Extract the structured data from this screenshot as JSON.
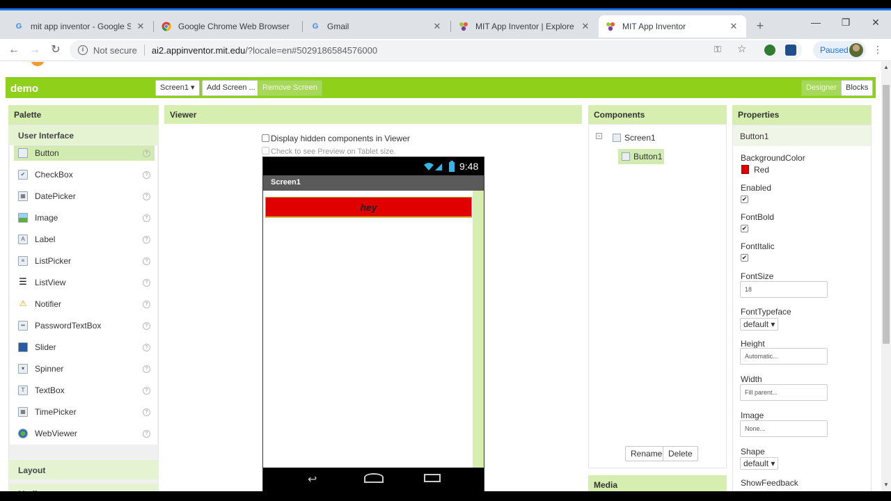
{
  "browser": {
    "tabs": [
      {
        "title": "mit app inventor - Google Sea",
        "icon": "google-g"
      },
      {
        "title": "Google Chrome Web Browser",
        "icon": "chrome"
      },
      {
        "title": "Gmail",
        "icon": "google-g"
      },
      {
        "title": "MIT App Inventor | Explore MI",
        "icon": "app-inventor"
      },
      {
        "title": "MIT App Inventor",
        "icon": "app-inventor"
      }
    ],
    "address": {
      "security_label": "Not secure",
      "host": "ai2.appinventor.mit.edu",
      "path": "/?locale=en#5029186584576000"
    },
    "profile_status": "Paused"
  },
  "project": {
    "name": "demo",
    "screen_select": "Screen1 ▾",
    "add_screen": "Add Screen ...",
    "remove_screen": "Remove Screen",
    "designer": "Designer",
    "blocks": "Blocks"
  },
  "palette": {
    "title": "Palette",
    "category": "User Interface",
    "items": [
      {
        "label": "Button",
        "icon": "button-icon"
      },
      {
        "label": "CheckBox",
        "icon": "checkbox-icon"
      },
      {
        "label": "DatePicker",
        "icon": "datepicker-icon"
      },
      {
        "label": "Image",
        "icon": "image-icon"
      },
      {
        "label": "Label",
        "icon": "label-icon"
      },
      {
        "label": "ListPicker",
        "icon": "listpicker-icon"
      },
      {
        "label": "ListView",
        "icon": "listview-icon"
      },
      {
        "label": "Notifier",
        "icon": "notifier-icon"
      },
      {
        "label": "PasswordTextBox",
        "icon": "password-icon"
      },
      {
        "label": "Slider",
        "icon": "slider-icon"
      },
      {
        "label": "Spinner",
        "icon": "spinner-icon"
      },
      {
        "label": "TextBox",
        "icon": "textbox-icon"
      },
      {
        "label": "TimePicker",
        "icon": "timepicker-icon"
      },
      {
        "label": "WebViewer",
        "icon": "webviewer-icon"
      }
    ],
    "help_glyph": "?",
    "layout": "Layout",
    "media": "Media"
  },
  "viewer": {
    "title": "Viewer",
    "show_hidden": "Display hidden components in Viewer",
    "tablet_preview": "Check to see Preview on Tablet size.",
    "clock": "9:48",
    "screen_title": "Screen1",
    "button_text": "hey",
    "button_color": "#e00000"
  },
  "components": {
    "title": "Components",
    "tree": [
      "Screen1",
      "Button1"
    ],
    "rename": "Rename",
    "delete": "Delete",
    "media": "Media"
  },
  "properties": {
    "title": "Properties",
    "component": "Button1",
    "background_color_label": "BackgroundColor",
    "background_color_value": "Red",
    "enabled_label": "Enabled",
    "font_bold_label": "FontBold",
    "font_italic_label": "FontItalic",
    "font_size_label": "FontSize",
    "font_size_value": "18",
    "font_typeface_label": "FontTypeface",
    "font_typeface_value": "default ▾",
    "height_label": "Height",
    "height_value": "Automatic...",
    "width_label": "Width",
    "width_value": "Fill parent...",
    "image_label": "Image",
    "image_value": "None...",
    "shape_label": "Shape",
    "shape_value": "default ▾",
    "show_feedback_label": "ShowFeedback",
    "check_glyph": "✔"
  },
  "colors": {
    "accent_green": "#8fd11a",
    "panel_header": "#d6eeb0",
    "button_red": "#e00000"
  }
}
